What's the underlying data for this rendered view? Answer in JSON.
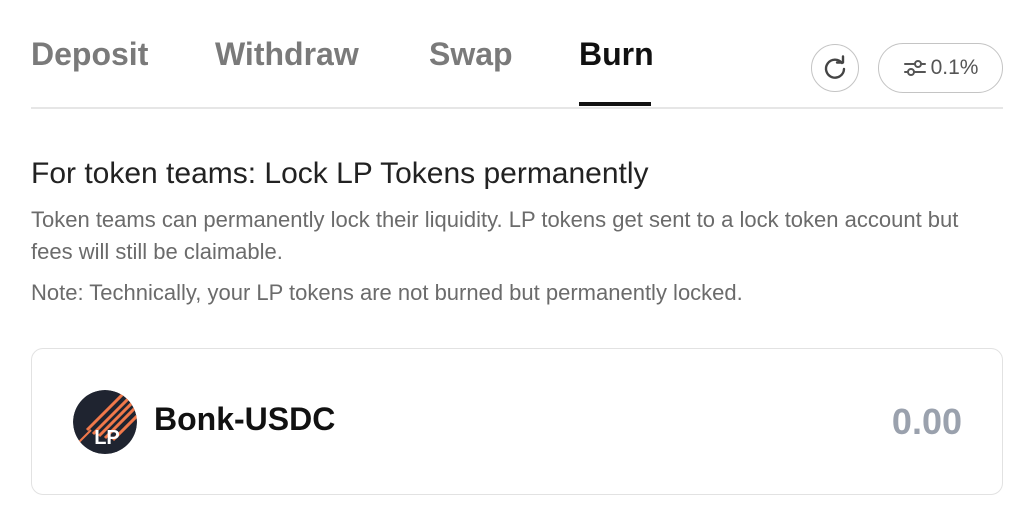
{
  "tabs": [
    {
      "label": "Deposit",
      "active": false
    },
    {
      "label": "Withdraw",
      "active": false
    },
    {
      "label": "Swap",
      "active": false
    },
    {
      "label": "Burn",
      "active": true
    }
  ],
  "toolbar": {
    "refresh_icon": "refresh-icon",
    "settings_icon": "sliders-icon",
    "slippage": "0.1%"
  },
  "burn": {
    "heading": "For token teams: Lock LP Tokens permanently",
    "description": "Token teams can permanently lock their liquidity. LP tokens get sent to a lock token account but fees will still be claimable.",
    "note": "Note: Technically, your LP tokens are not burned but permanently locked."
  },
  "token": {
    "logo_text": "LP",
    "name": "Bonk-USDC",
    "amount": "0.00"
  },
  "colors": {
    "logo_bg": "#1f2430",
    "logo_stripe": "#f0784a",
    "amount": "#9aa1ad",
    "active_tab": "#111111",
    "inactive_tab": "#7a7a7a"
  }
}
